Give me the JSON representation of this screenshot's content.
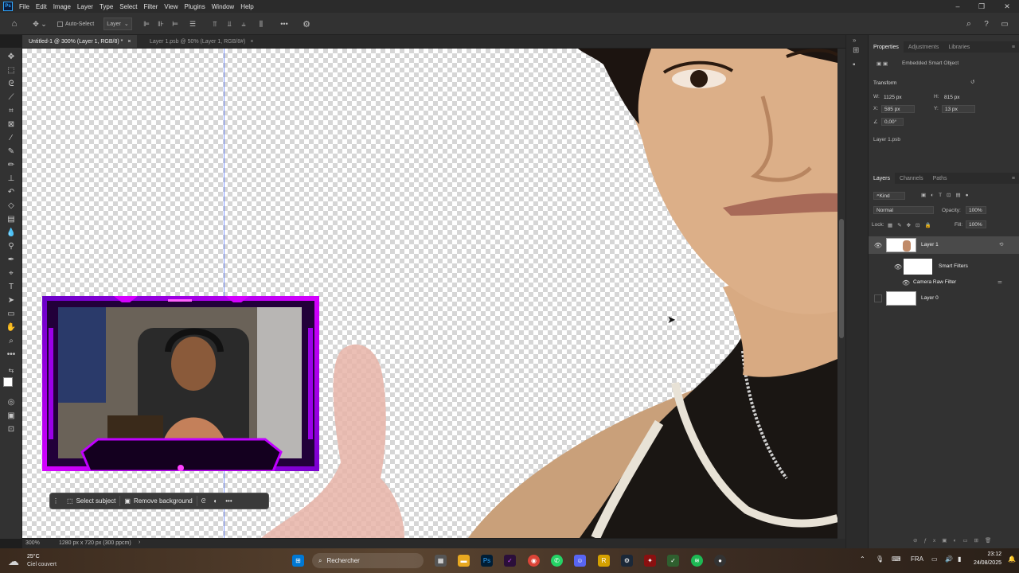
{
  "app": {
    "logo_text": "Ps",
    "menu": [
      "File",
      "Edit",
      "Image",
      "Layer",
      "Type",
      "Select",
      "Filter",
      "View",
      "Plugins",
      "Window",
      "Help"
    ]
  },
  "options_bar": {
    "auto_select_label": "Auto-Select",
    "auto_select_target": "Layer"
  },
  "document_tabs": [
    {
      "label": "Untitled-1 @ 300% (Layer 1, RGB/8) *",
      "active": true
    },
    {
      "label": "Layer 1.psb @ 50% (Layer 1, RGB/8#)",
      "active": false
    }
  ],
  "status": {
    "zoom": "300%",
    "doc_size": "1280 px x 720 px (300 ppcm)"
  },
  "context_bar": {
    "select_subject": "Select subject",
    "remove_background": "Remove background"
  },
  "properties_panel": {
    "tabs": [
      "Properties",
      "Adjustments",
      "Libraries"
    ],
    "object_type": "Embedded Smart Object",
    "section": "Transform",
    "w_label": "W:",
    "w_value": "1125 px",
    "h_label": "H:",
    "h_value": "815 px",
    "x_label": "X:",
    "x_value": "585 px",
    "y_label": "Y:",
    "y_value": "13 px",
    "angle_value": "0,00°",
    "linked_file": "Layer 1.psb"
  },
  "layers_panel": {
    "tabs": [
      "Layers",
      "Channels",
      "Paths"
    ],
    "filter_kind": "Kind",
    "blend_mode": "Normal",
    "opacity_label": "Opacity:",
    "opacity_value": "100%",
    "lock_label": "Lock:",
    "fill_label": "Fill:",
    "fill_value": "100%",
    "layers": [
      {
        "name": "Layer 1",
        "visible": true,
        "selected": true
      },
      {
        "name": "Smart Filters",
        "visible": true,
        "selected": false
      },
      {
        "name": "Camera Raw Filter",
        "visible": true,
        "selected": false
      },
      {
        "name": "Layer 0",
        "visible": false,
        "selected": false
      }
    ]
  },
  "taskbar": {
    "weather_temp": "25°C",
    "weather_desc": "Ciel couvert",
    "search_label": "Rechercher",
    "language": "FRA",
    "time": "23:12",
    "date": "24/08/2025"
  },
  "colors": {
    "accent": "#31a8ff",
    "frame_purple": "#b400ff",
    "guide_blue": "#4a6cff"
  }
}
